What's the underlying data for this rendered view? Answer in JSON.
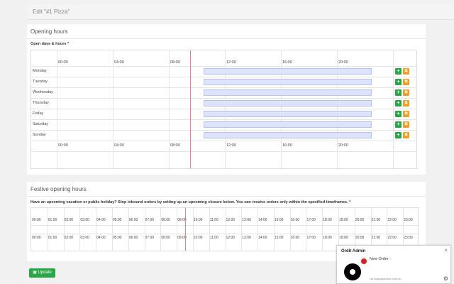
{
  "header": {
    "title": "Edit \"#1 Pizza\""
  },
  "opening": {
    "title": "Opening hours",
    "label": "Open days & hours *",
    "time_labels": [
      "00:00",
      "04:00",
      "08:00",
      "12:00",
      "16:00",
      "20:00"
    ],
    "days": [
      "Monday",
      "Tuesday",
      "Wednesday",
      "Thursday",
      "Friday",
      "Saturday",
      "Sunday"
    ],
    "open_from": 10.5,
    "open_to": 22.5,
    "current_time": 9.5,
    "add_label": "+",
    "copy_label": "⧉"
  },
  "festive": {
    "title": "Festive opening hours",
    "description": "Have an upcoming vacation or public holiday? Stop inbound orders by setting up an upcoming closure below. You can receive orders only within the specified timeframes. *",
    "hours": [
      "00:00",
      "01:00",
      "02:00",
      "03:00",
      "04:00",
      "05:00",
      "06:00",
      "07:00",
      "08:00",
      "09:00",
      "10:00",
      "11:00",
      "12:00",
      "13:00",
      "14:00",
      "15:00",
      "16:00",
      "17:00",
      "18:00",
      "19:00",
      "20:00",
      "21:00",
      "22:00",
      "23:00"
    ],
    "current_time": 9.5
  },
  "update_button": {
    "label": "Update"
  },
  "notification": {
    "title": "Ordit Admin",
    "message": "New Order -",
    "url": "via stagingadmin.ordit.hu",
    "close": "×"
  },
  "colors": {
    "green": "#28a745",
    "orange": "#f0a020",
    "bar": "#dde3fb",
    "now": "#f27f7f"
  },
  "icons": {
    "close": "close-icon",
    "gear": "gear-icon",
    "logo": "ordit-logo-icon"
  }
}
